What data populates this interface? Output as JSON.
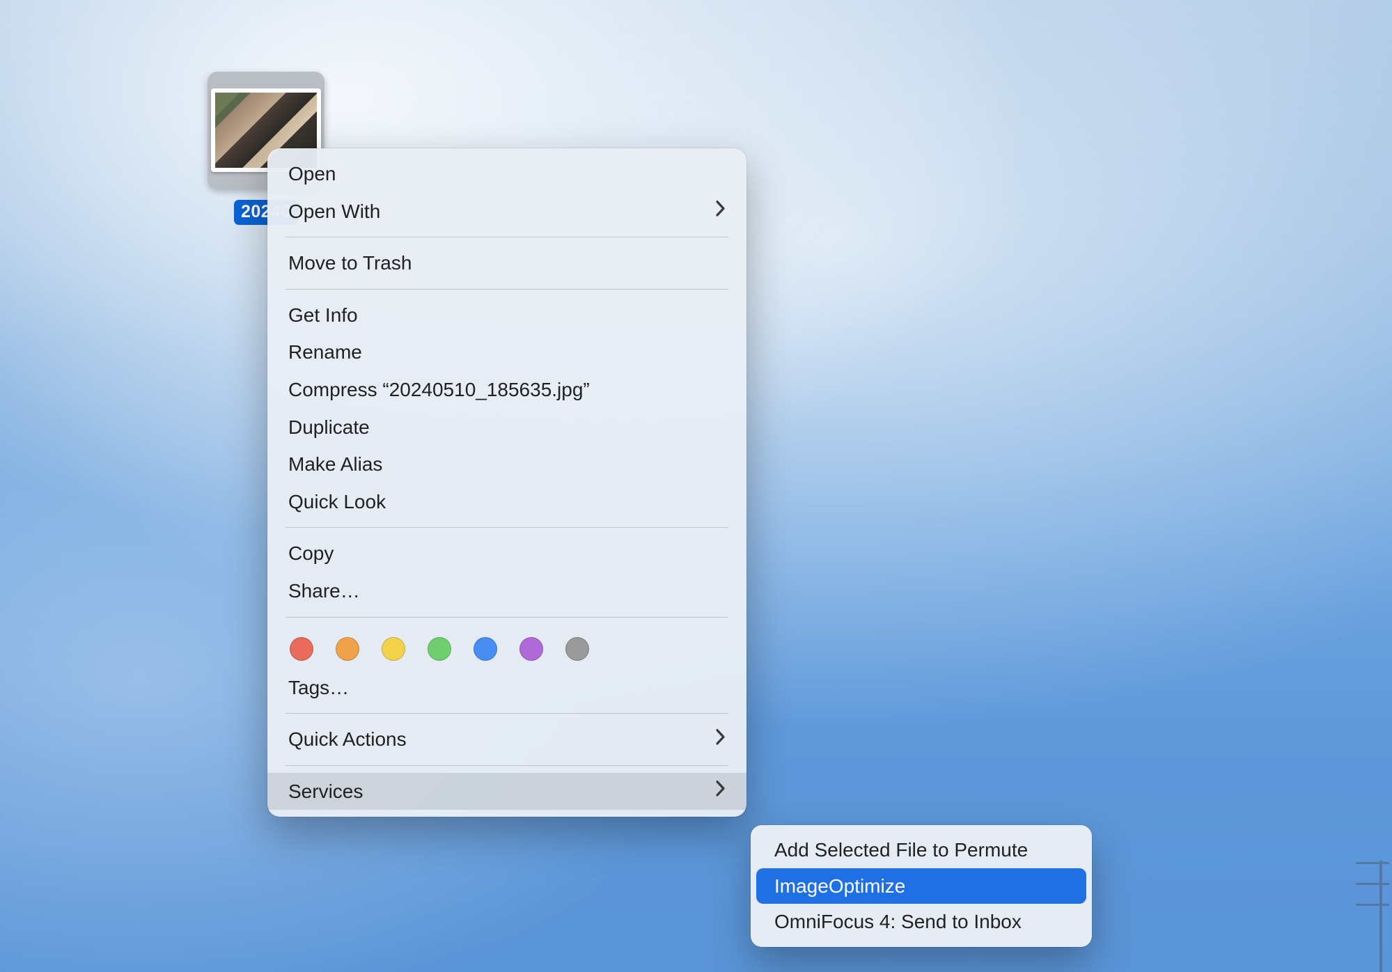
{
  "file": {
    "label_visible": "20240"
  },
  "menu": {
    "items": {
      "open": "Open",
      "open_with": "Open With",
      "move_to_trash": "Move to Trash",
      "get_info": "Get Info",
      "rename": "Rename",
      "compress": "Compress “20240510_185635.jpg”",
      "duplicate": "Duplicate",
      "make_alias": "Make Alias",
      "quick_look": "Quick Look",
      "copy": "Copy",
      "share": "Share…",
      "tags": "Tags…",
      "quick_actions": "Quick Actions",
      "services": "Services"
    },
    "highlighted": "services"
  },
  "tag_colors": {
    "red": "#e86b5c",
    "orange": "#f0a24a",
    "yellow": "#f2d24a",
    "green": "#6fcf6f",
    "blue": "#4a8df2",
    "purple": "#b069d9",
    "gray": "#9a9a9a"
  },
  "submenu": {
    "items": {
      "add_to_permute": "Add Selected File to Permute",
      "image_optimize": "ImageOptimize",
      "omnifocus_send": "OmniFocus 4: Send to Inbox"
    },
    "selected": "image_optimize"
  }
}
